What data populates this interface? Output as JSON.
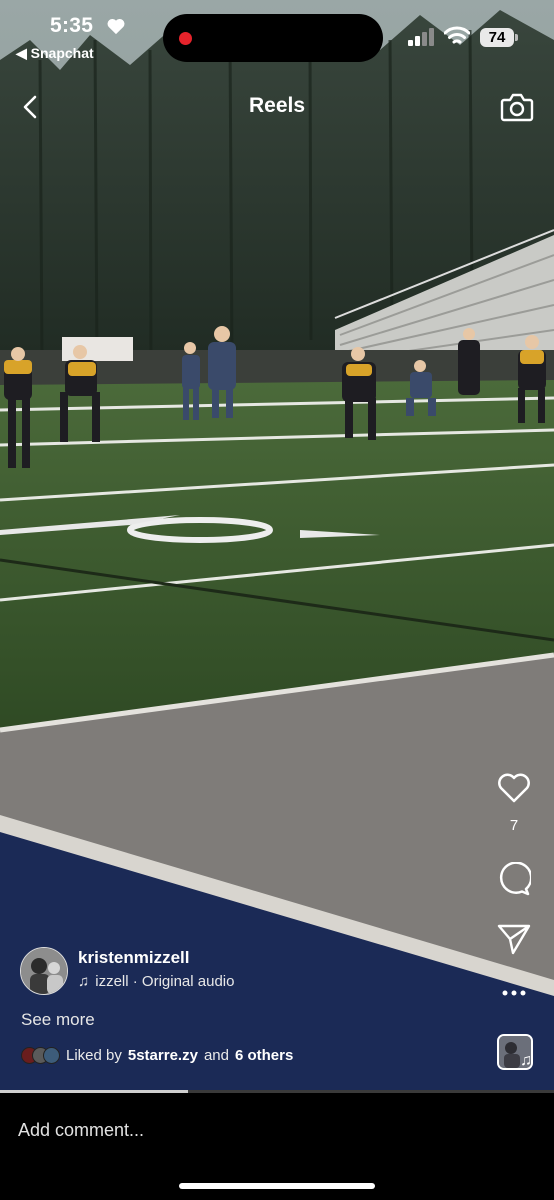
{
  "status_bar": {
    "time": "5:35",
    "back_app": "◀ Snapchat",
    "battery": "74",
    "recording_color": "#e5232b"
  },
  "header": {
    "title": "Reels",
    "back_icon": "chevron-left-icon",
    "camera_icon": "camera-icon"
  },
  "actions": {
    "like_count": "7",
    "icons": [
      "heart-icon",
      "comment-icon",
      "send-icon",
      "more-icon"
    ]
  },
  "post": {
    "username": "kristenmizzell",
    "audio_prefix": "♫",
    "audio_text": "izzell · Original audio",
    "see_more": "See more",
    "liked_by_prefix": "Liked by",
    "liked_by_user": "5starre.zy",
    "liked_by_and": "and",
    "liked_by_others": "6 others"
  },
  "video_progress": 0.34,
  "comment": {
    "placeholder": "Add comment..."
  },
  "colors": {
    "field_green": "#3f5a30",
    "track_gray": "#7e7b78",
    "navy": "#1a2a55"
  }
}
